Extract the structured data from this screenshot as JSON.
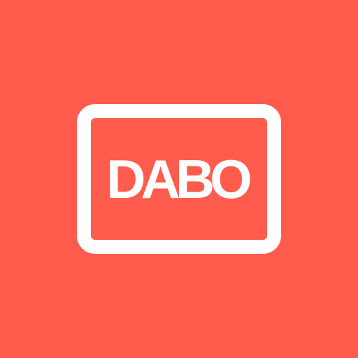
{
  "logo": {
    "text": "DABO",
    "background_color": "#FF5C4D",
    "foreground_color": "#FFFFFF"
  }
}
